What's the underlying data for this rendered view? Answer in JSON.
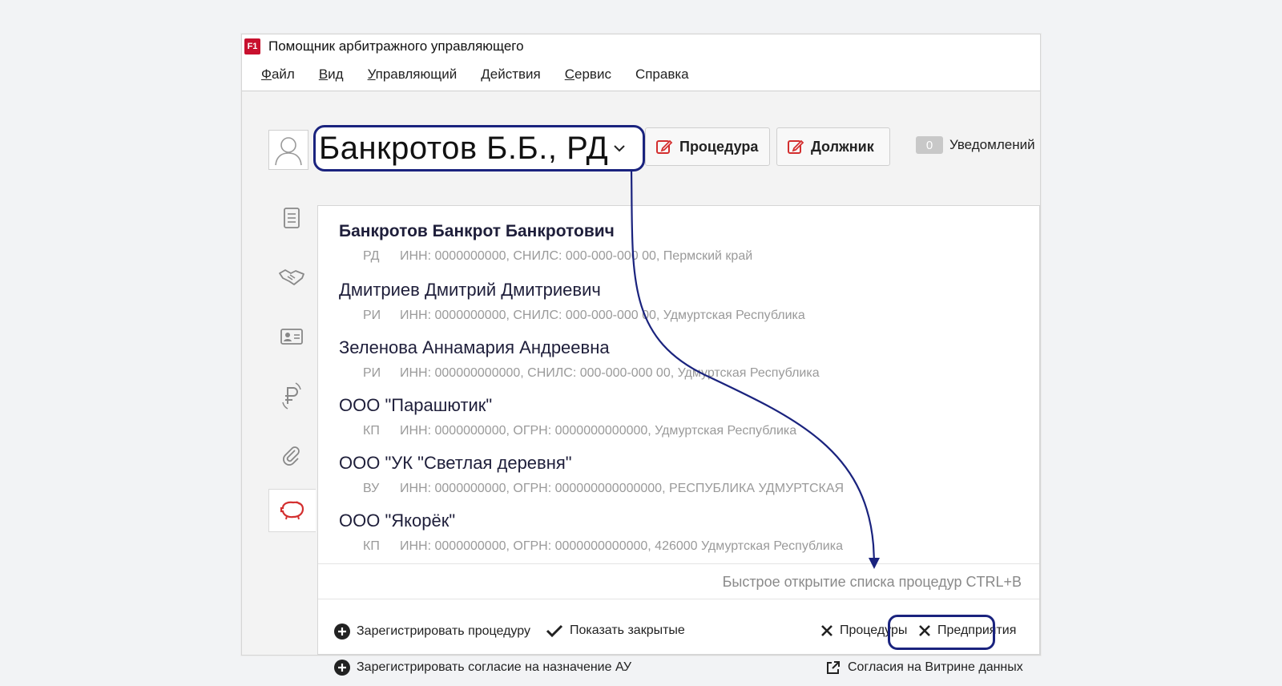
{
  "app": {
    "logo_text": "F1",
    "title": "Помощник арбитражного управляющего"
  },
  "menu": [
    {
      "underline": "Ф",
      "rest": "айл"
    },
    {
      "underline": "В",
      "rest": "ид"
    },
    {
      "underline": "У",
      "rest": "правляющий"
    },
    {
      "underline": "",
      "rest": "Действия"
    },
    {
      "underline": "С",
      "rest": "ервис"
    },
    {
      "underline": "",
      "rest": "Справка"
    }
  ],
  "toolbar": {
    "debtor_selected": "Банкротов Б.Б., РД",
    "procedure_label": "Процедура",
    "debtor_label": "Должник",
    "notifications_count": "0",
    "notifications_label": "Уведомлений"
  },
  "debtors": [
    {
      "name": "Банкротов Банкрот Банкротович",
      "type": "РД",
      "details": "ИНН: 0000000000, СНИЛС: 000-000-000 00, Пермский край",
      "bold": true
    },
    {
      "name": "Дмитриев Дмитрий Дмитриевич",
      "type": "РИ",
      "details": "ИНН: 0000000000, СНИЛС: 000-000-000 00, Удмуртская Республика",
      "bold": false
    },
    {
      "name": "Зеленова Аннамария Андреевна",
      "type": "РИ",
      "details": "ИНН: 000000000000, СНИЛС: 000-000-000 00, Удмуртская Республика",
      "bold": false
    },
    {
      "name": "ООО \"Парашютик\"",
      "type": "КП",
      "details": "ИНН: 0000000000, ОГРН: 0000000000000, Удмуртская Республика",
      "bold": false
    },
    {
      "name": "ООО \"УК \"Светлая деревня\"",
      "type": "ВУ",
      "details": "ИНН: 0000000000, ОГРН: 000000000000000, РЕСПУБЛИКА УДМУРТСКАЯ",
      "bold": false
    },
    {
      "name": "ООО \"Якорёк\"",
      "type": "КП",
      "details": "ИНН: 0000000000, ОГРН: 0000000000000, 426000 Удмуртская Республика",
      "bold": false
    }
  ],
  "dropdown": {
    "hint": "Быстрое открытие списка процедур CTRL+B",
    "register_procedure": "Зарегистрировать процедуру",
    "show_closed": "Показать закрытые",
    "procedures": "Процедуры",
    "enterprises": "Предприятия",
    "register_consent": "Зарегистрировать согласие на назначение АУ",
    "data_showcase": "Согласия на Витрине данных"
  },
  "colors": {
    "accent": "#c8102e",
    "annotation": "#1a237e"
  }
}
